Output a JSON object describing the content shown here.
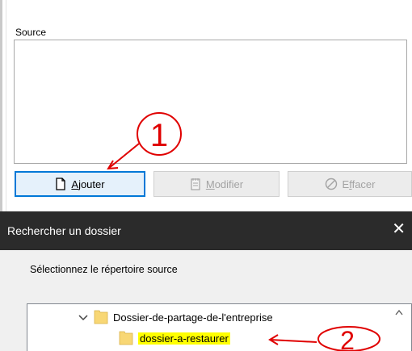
{
  "source": {
    "label": "Source"
  },
  "buttons": {
    "add": {
      "mnemonic": "A",
      "rest": "jouter"
    },
    "modify": {
      "mnemonic": "M",
      "rest": "odifier"
    },
    "erase": {
      "prefix": "E",
      "mnemonic": "f",
      "rest": "facer"
    }
  },
  "dialog": {
    "title": "Rechercher un dossier",
    "close": "✕",
    "prompt": "Sélectionnez le répertoire source",
    "tree": [
      {
        "label": "Dossier-de-partage-de-l'entreprise",
        "expanded": true
      },
      {
        "label": "dossier-a-restaurer",
        "highlighted": true
      }
    ]
  },
  "annotations": [
    "1",
    "2"
  ],
  "colors": {
    "accent": "#0078d7",
    "annotation": "#e00000",
    "highlight": "#ffff00",
    "folder": "#f8d775"
  }
}
